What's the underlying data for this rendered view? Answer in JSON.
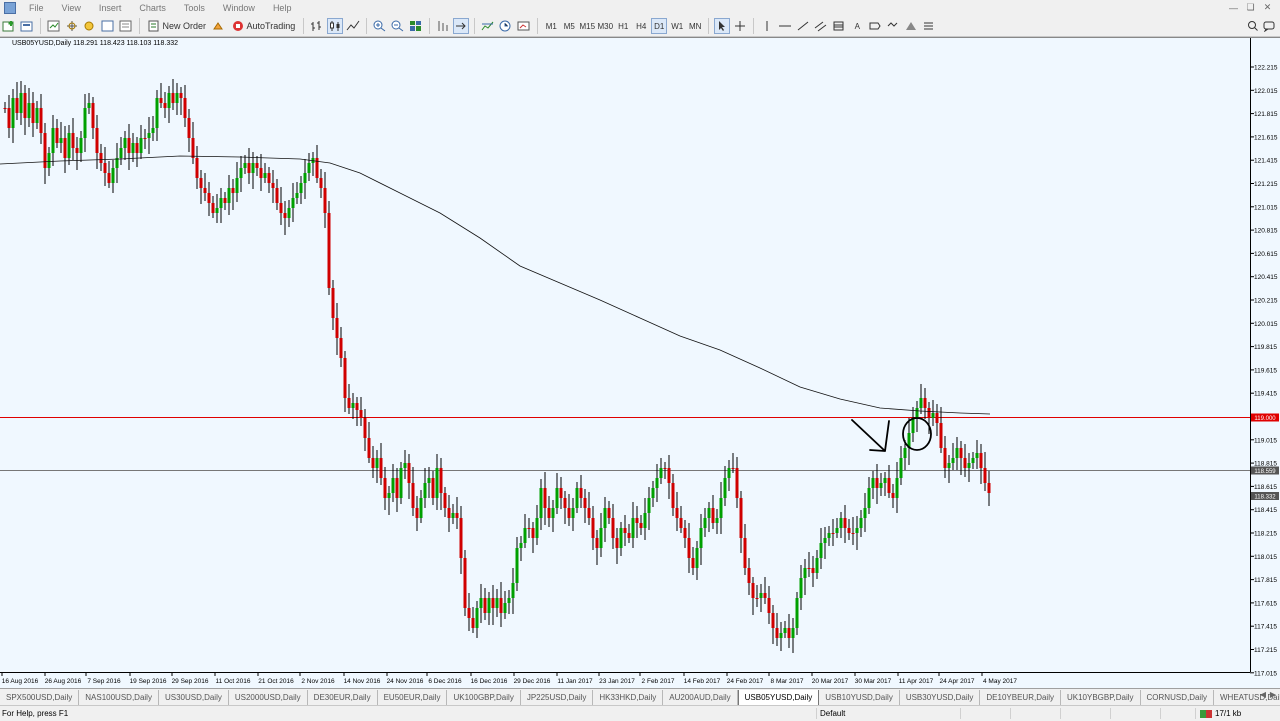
{
  "menu": [
    "File",
    "View",
    "Insert",
    "Charts",
    "Tools",
    "Window",
    "Help"
  ],
  "toolbar": {
    "new_order": "New Order",
    "autotrading": "AutoTrading",
    "timeframes": [
      "M1",
      "M5",
      "M15",
      "M30",
      "H1",
      "H4",
      "D1",
      "W1",
      "MN"
    ]
  },
  "chart": {
    "info": "USB05YUSD,Daily  118.291 118.423 118.103 118.332",
    "price_labels": [
      "122.215",
      "122.015",
      "121.815",
      "121.615",
      "121.415",
      "121.215",
      "121.015",
      "120.815",
      "120.615",
      "120.415",
      "120.215",
      "120.015",
      "119.815",
      "119.615",
      "119.415",
      "119.215",
      "119.015",
      "118.815",
      "118.615",
      "118.415",
      "118.215",
      "118.015",
      "117.815",
      "117.615",
      "117.415",
      "117.215",
      "117.015",
      "116.815"
    ],
    "h_lines": [
      {
        "label": "119.000",
        "color": "#e00000"
      },
      {
        "label": "118.559",
        "color": "#777777"
      },
      {
        "label": "118.332",
        "color": "#777777"
      }
    ],
    "date_labels": [
      "16 Aug 2016",
      "26 Aug 2016",
      "7 Sep 2016",
      "19 Sep 2016",
      "29 Sep 2016",
      "11 Oct 2016",
      "21 Oct 2016",
      "2 Nov 2016",
      "14 Nov 2016",
      "24 Nov 2016",
      "6 Dec 2016",
      "16 Dec 2016",
      "29 Dec 2016",
      "11 Jan 2017",
      "23 Jan 2017",
      "2 Feb 2017",
      "14 Feb 2017",
      "24 Feb 2017",
      "8 Mar 2017",
      "20 Mar 2017",
      "30 Mar 2017",
      "11 Apr 2017",
      "24 Apr 2017",
      "4 May 2017"
    ],
    "colors": {
      "bull": "#00a000",
      "bear": "#d00000",
      "ma": "#111111",
      "bg": "#f0f8ff"
    }
  },
  "tabs": [
    "SPX500USD,Daily",
    "NAS100USD,Daily",
    "US30USD,Daily",
    "US2000USD,Daily",
    "DE30EUR,Daily",
    "EU50EUR,Daily",
    "UK100GBP,Daily",
    "JP225USD,Daily",
    "HK33HKD,Daily",
    "AU200AUD,Daily",
    "USB05YUSD,Daily",
    "USB10YUSD,Daily",
    "USB30YUSD,Daily",
    "DE10YBEUR,Daily",
    "UK10YBGBP,Daily",
    "CORNUSD,Daily",
    "WHEATUSD,Daily",
    "SC"
  ],
  "active_tab": "USB05YUSD,Daily",
  "status": {
    "help": "For Help, press F1",
    "profile": "Default",
    "connection": "17/1 kb"
  }
}
